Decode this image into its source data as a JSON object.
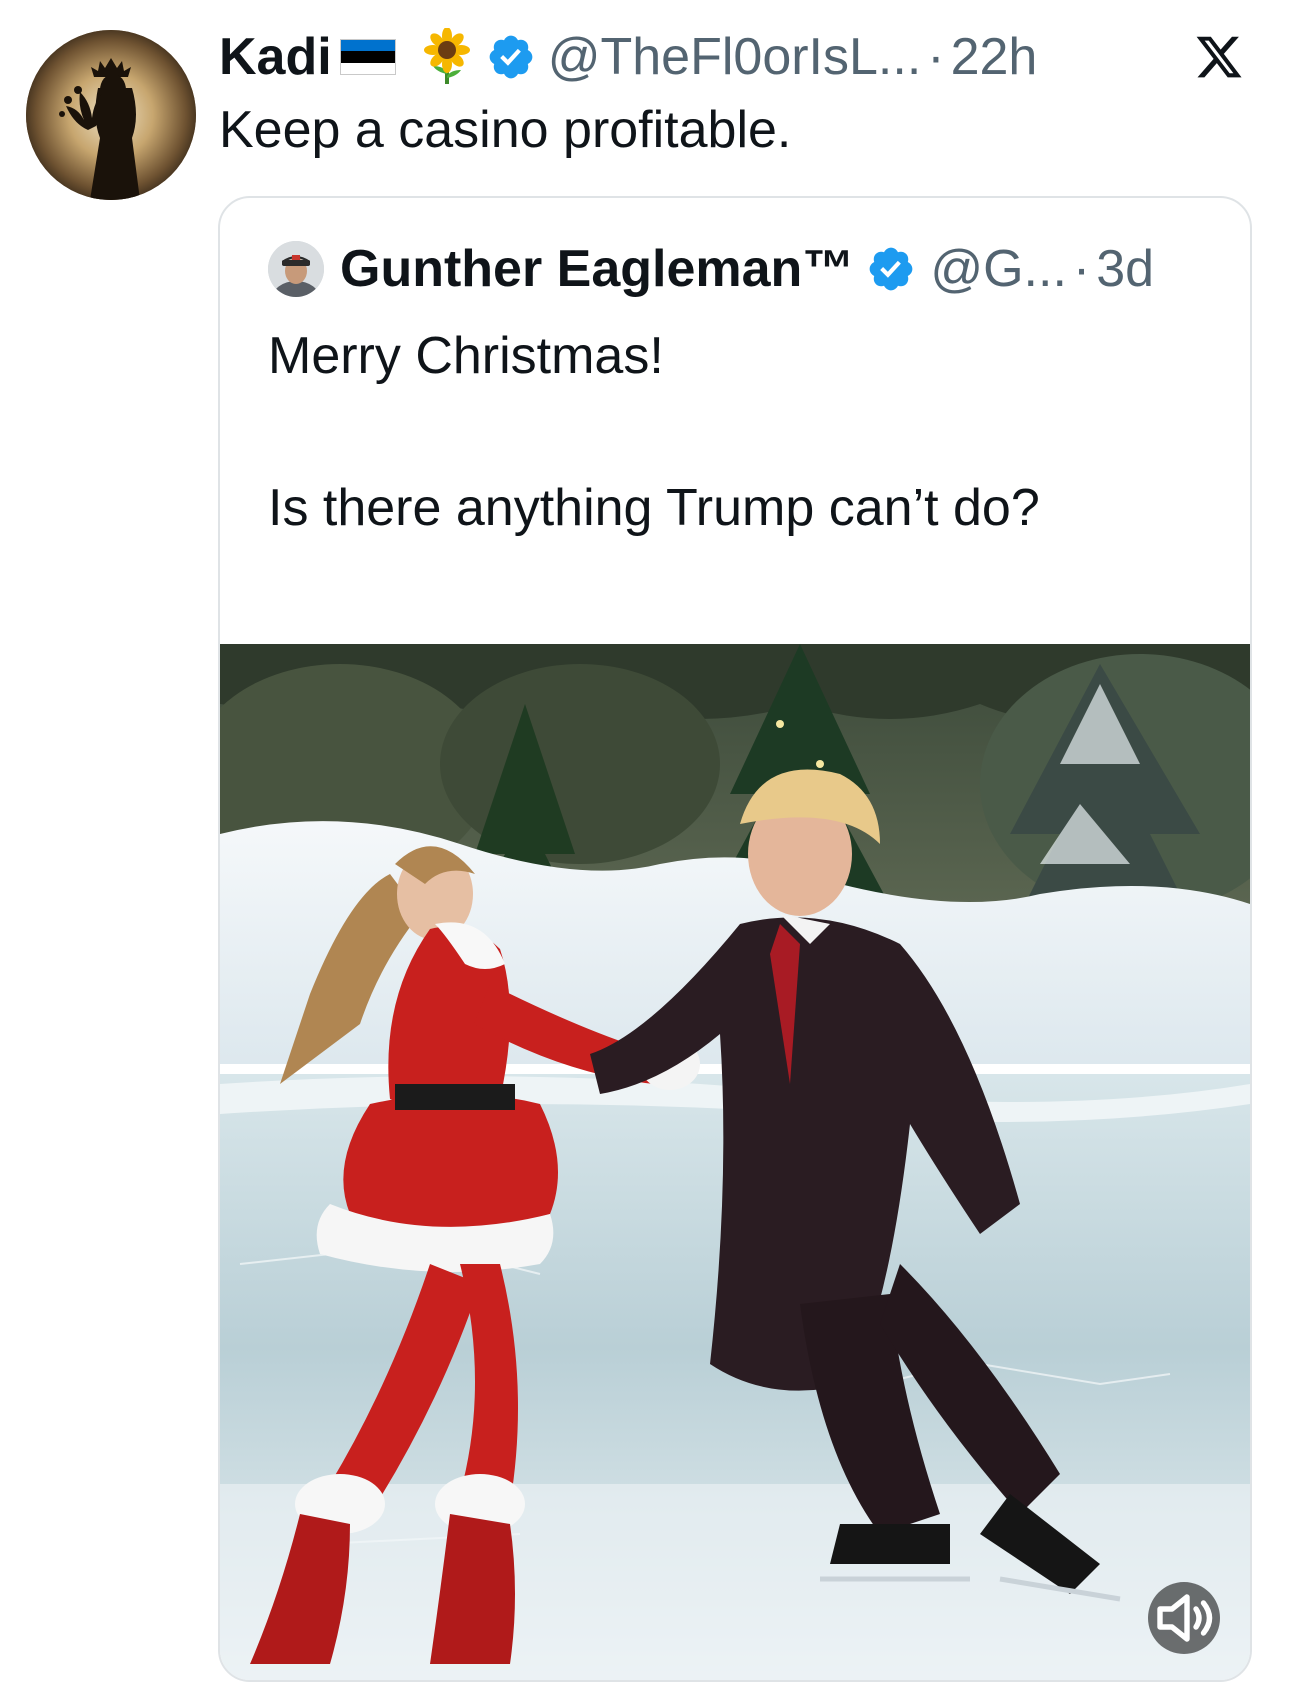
{
  "post": {
    "author": {
      "display_name": "Kadi",
      "flag": {
        "icon": "estonia-flag-icon",
        "colors": [
          "#0072ce",
          "#000000",
          "#ffffff"
        ]
      },
      "emoji": "sunflower-icon",
      "verified": true,
      "handle": "@TheFl0orIsL...",
      "time": "22h"
    },
    "dot": "·",
    "text": "Keep a casino profitable.",
    "platform_icon": "x-logo-icon"
  },
  "quote": {
    "author": {
      "display_name": "Gunther Eagleman™",
      "verified": true,
      "handle": "@G...",
      "time": "3d"
    },
    "dot": "·",
    "lines": [
      "Merry Christmas!",
      "Is there anything Trump can’t do?"
    ],
    "emoji": "face-with-tears-of-joy-icon",
    "media": {
      "kind": "video",
      "description_icon": "video-thumbnail",
      "volume_icon": "speaker-muted-icon"
    }
  },
  "colors": {
    "verified_blue": "#1d9bf0",
    "secondary_text": "#536471",
    "primary_text": "#0f1419",
    "border": "#dfe3e6"
  }
}
